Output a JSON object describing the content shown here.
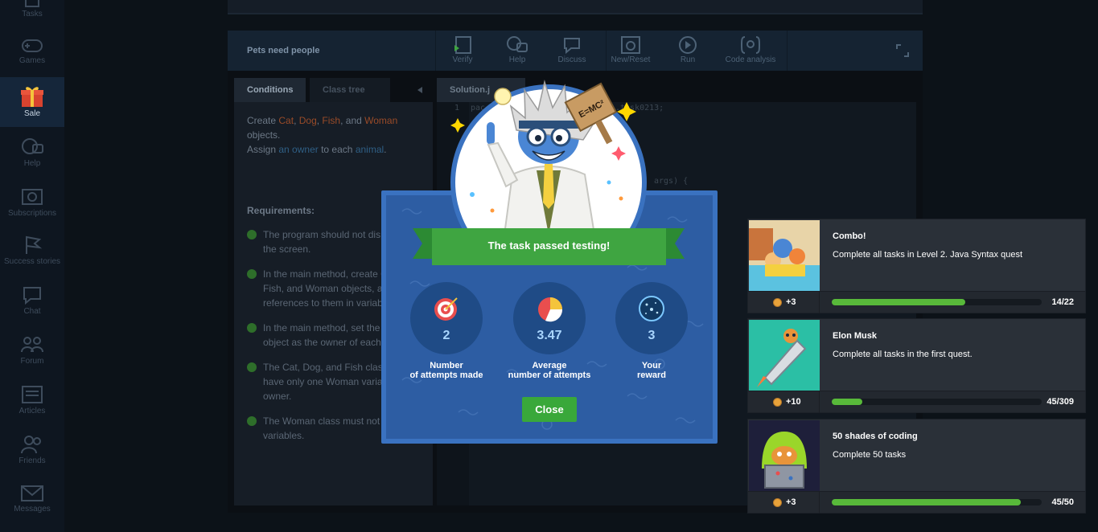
{
  "sidebar": {
    "items": [
      {
        "label": "Tasks",
        "icon": "tasks-icon"
      },
      {
        "label": "Games",
        "icon": "gamepad-icon"
      },
      {
        "label": "Sale",
        "icon": "gift-icon",
        "active": true
      },
      {
        "label": "Help",
        "icon": "help-bubbles-icon"
      },
      {
        "label": "Subscriptions",
        "icon": "subscriptions-icon"
      },
      {
        "label": "Success stories",
        "icon": "flag-icon"
      },
      {
        "label": "Chat",
        "icon": "chat-icon"
      },
      {
        "label": "Forum",
        "icon": "forum-icon"
      },
      {
        "label": "Articles",
        "icon": "articles-icon"
      },
      {
        "label": "Friends",
        "icon": "friends-icon"
      },
      {
        "label": "Messages",
        "icon": "envelope-icon"
      }
    ]
  },
  "ide": {
    "task_title": "Pets need people",
    "toolbar": {
      "verify": "Verify",
      "help": "Help",
      "discuss": "Discuss",
      "reset": "New/Reset",
      "run": "Run",
      "analysis": "Code analysis"
    },
    "tabs": {
      "conditions": "Conditions",
      "class_tree": "Class tree",
      "solution": "Solution.j"
    },
    "conditions": {
      "create": "Create",
      "cat": "Cat",
      "dog": "Dog",
      "fish": "Fish",
      "and": "and",
      "woman": "Woman",
      "objects": "objects.",
      "assign": "Assign",
      "an_owner": "an owner",
      "to_each": "to each",
      "animal": "animal",
      "period": "."
    },
    "requirements_title": "Requirements:",
    "requirements": [
      "The program should not display text on the screen.",
      "In the main method, create Cat, Dog, Fish, and Woman objects, and save references to them in variables.",
      "In the main method, set the Woman object as the owner of each animal.",
      "The Cat, Dog, and Fish classes should have only one Woman variable named owner.",
      "The Woman class must not have any variables."
    ],
    "code": {
      "line1_num": "1",
      "line1_start": "pac",
      "line1_end": ".task0213;",
      "line_args": "args) {"
    }
  },
  "modal": {
    "sign_text": "E=MC²",
    "banner": "The task passed testing!",
    "stats": [
      {
        "value": "2",
        "label_1": "Number",
        "label_2": "of attempts made",
        "icon": "target-icon"
      },
      {
        "value": "3.47",
        "label_1": "Average",
        "label_2": "number of attempts",
        "icon": "pie-chart-icon"
      },
      {
        "value": "3",
        "label_1": "Your",
        "label_2": "reward",
        "icon": "galaxy-icon"
      }
    ],
    "close_label": "Close"
  },
  "achievements": [
    {
      "title": "Combo!",
      "desc": "Complete all tasks in Level 2. Java Syntax quest",
      "points": "+3",
      "progress": "14/22",
      "fraction": 0.636
    },
    {
      "title": "Elon Musk",
      "desc": "Complete all tasks in the first quest.",
      "points": "+10",
      "progress": "45/309",
      "fraction": 0.146
    },
    {
      "title": "50 shades of coding",
      "desc": "Complete 50 tasks",
      "points": "+3",
      "progress": "45/50",
      "fraction": 0.9
    }
  ],
  "colors": {
    "accent_green": "#3fa541",
    "modal_blue": "#2d5da3",
    "progress_green": "#58b93a"
  }
}
